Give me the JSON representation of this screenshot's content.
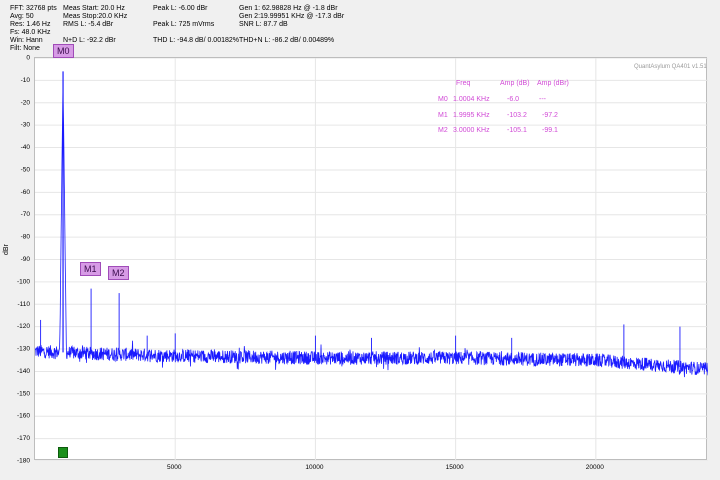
{
  "stats": {
    "fft": "FFT: 32768 pts",
    "avg": "Avg: 50",
    "res": "Res: 1.46 Hz",
    "fs": "Fs: 48.0 KHz",
    "win": "Win: Hann",
    "filt": "Filt: None",
    "meas_start": "Meas Start: 20.0 Hz",
    "meas_stop": "Meas Stop:20.0 KHz",
    "rms": "RMS L: -5.4 dBr",
    "peak_dbr": "Peak L: -6.00 dBr",
    "peak_mv": "Peak L: 725 mVrms",
    "gen1": "Gen 1: 62.98828 Hz @ -1.8  dBr",
    "gen2": "Gen 2:19.99951 KHz @ -17.3  dBr",
    "snr": "SNR L: 87.7 dB",
    "nd": "N+D L: -92.2 dBr",
    "thd": "THD L: -94.8 dB/ 0.00182%",
    "thdn": "THD+N L: -86.2 dB/ 0.00489%"
  },
  "watermark": "QuantAsylum QA401 v1.51",
  "markers": [
    {
      "label": "M0"
    },
    {
      "label": "M1"
    },
    {
      "label": "M2"
    }
  ],
  "marker_table": {
    "headers": [
      "Freq",
      "Amp (dB)",
      "Amp (dBr)"
    ],
    "rows": [
      {
        "name": "M0",
        "freq": "1.0004 KHz",
        "amp_db": "-6.0",
        "amp_dbr": "---"
      },
      {
        "name": "M1",
        "freq": "1.9995 KHz",
        "amp_db": "-103.2",
        "amp_dbr": "-97.2"
      },
      {
        "name": "M2",
        "freq": "3.0000 KHz",
        "amp_db": "-105.1",
        "amp_dbr": "-99.1"
      }
    ]
  },
  "colors": {
    "trace": "#1a1aff",
    "marker_fill": "#d79be6",
    "table_text": "#d14ad6"
  },
  "chart_data": {
    "type": "line",
    "xlabel": "",
    "ylabel": "dBr",
    "xlim": [
      0,
      24000
    ],
    "ylim": [
      -180,
      0
    ],
    "x_ticks": [
      5000,
      10000,
      15000,
      20000
    ],
    "y_ticks": [
      0,
      -10,
      -20,
      -30,
      -40,
      -50,
      -60,
      -70,
      -80,
      -90,
      -100,
      -110,
      -120,
      -130,
      -140,
      -150,
      -160,
      -170,
      -180
    ],
    "grid": true,
    "noise_floor": [
      [
        0,
        -131
      ],
      [
        2000,
        -132
      ],
      [
        5000,
        -133
      ],
      [
        10000,
        -134
      ],
      [
        15000,
        -134
      ],
      [
        20000,
        -135
      ],
      [
        24000,
        -139
      ]
    ],
    "peaks": [
      {
        "x": 1000,
        "y": -6
      },
      {
        "x": 2000,
        "y": -103
      },
      {
        "x": 3000,
        "y": -105
      },
      {
        "x": 200,
        "y": -117
      },
      {
        "x": 4000,
        "y": -124
      },
      {
        "x": 5000,
        "y": -123
      },
      {
        "x": 10000,
        "y": -124
      },
      {
        "x": 12000,
        "y": -125
      },
      {
        "x": 15000,
        "y": -124
      },
      {
        "x": 17000,
        "y": -125
      },
      {
        "x": 21000,
        "y": -119
      },
      {
        "x": 23000,
        "y": -120
      }
    ]
  }
}
